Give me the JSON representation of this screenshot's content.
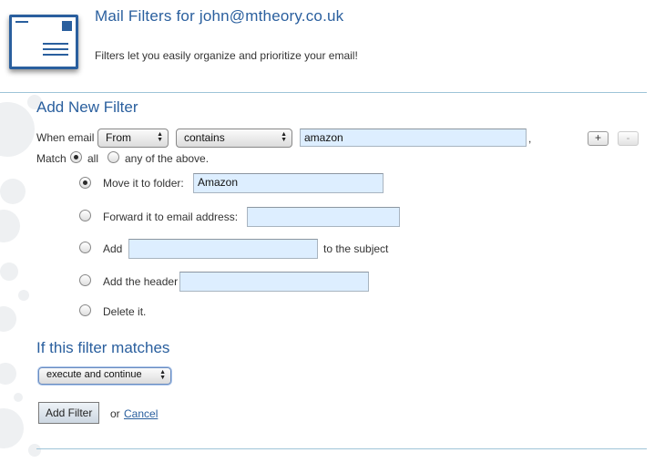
{
  "header": {
    "title": "Mail Filters for john@mtheory.co.uk",
    "subtitle": "Filters let you easily organize and prioritize your email!"
  },
  "add_filter": {
    "section_title": "Add New Filter",
    "when_email_label": "When email",
    "field_select": "From",
    "condition_select": "contains",
    "match_value": "amazon",
    "trailing_comma": ",",
    "add_rule_label": "+",
    "remove_rule_label": "-",
    "match_label": "Match",
    "match_all_label": "all",
    "match_any_label": "any of the above.",
    "match_mode": "all"
  },
  "actions": {
    "selected": "move",
    "move_label": "Move it to folder:",
    "move_value": "Amazon",
    "forward_label": "Forward it to email address:",
    "forward_value": "",
    "add_label": "Add",
    "add_value": "",
    "add_suffix": "to the subject",
    "header_label": "Add the header",
    "header_value": "",
    "delete_label": "Delete it."
  },
  "on_match": {
    "section_title": "If this filter matches",
    "select_value": "execute and continue"
  },
  "footer": {
    "submit_label": "Add Filter",
    "or_label": "or",
    "cancel_label": "Cancel"
  },
  "colors": {
    "accent": "#2a5f9e",
    "input_bg": "#ddeeff",
    "rule": "#9ec4d8"
  }
}
